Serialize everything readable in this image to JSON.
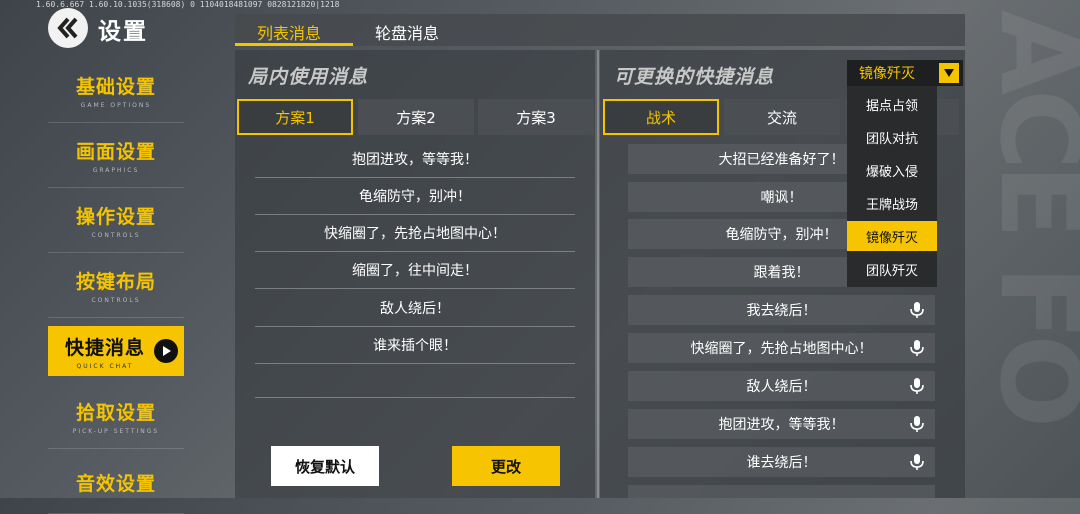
{
  "version_text": "1.60.6.667 1.60.10.1035(318608) 0 1104018481097 0828121820|1218",
  "header": {
    "title": "设置",
    "back_icon": "back-chevrons-icon"
  },
  "sidebar": {
    "items": [
      {
        "label": "基础设置",
        "sub": "GAME OPTIONS"
      },
      {
        "label": "画面设置",
        "sub": "GRAPHICS"
      },
      {
        "label": "操作设置",
        "sub": "CONTROLS"
      },
      {
        "label": "按键布局",
        "sub": "CONTROLS"
      },
      {
        "label": "快捷消息",
        "sub": "QUICK CHAT",
        "active": true
      },
      {
        "label": "拾取设置",
        "sub": "PICK-UP SETTINGS"
      },
      {
        "label": "音效设置",
        "sub": ""
      }
    ]
  },
  "tabs": [
    {
      "label": "列表消息",
      "active": true
    },
    {
      "label": "轮盘消息"
    }
  ],
  "left_panel": {
    "title": "局内使用消息",
    "schemes": [
      "方案1",
      "方案2",
      "方案3"
    ],
    "active_scheme": "方案1",
    "messages": [
      "抱团进攻，等等我！",
      "龟缩防守，别冲！",
      "快缩圈了，先抢占地图中心！",
      "缩圈了，往中间走！",
      "敌人绕后！",
      "谁来插个眼！",
      ""
    ],
    "reset_label": "恢复默认",
    "change_label": "更改"
  },
  "right_panel": {
    "title": "可更换的快捷消息",
    "categories": [
      "战术",
      "交流",
      ""
    ],
    "active_category": "战术",
    "messages": [
      "大招已经准备好了！",
      "嘲讽！",
      "龟缩防守，别冲！",
      "跟着我！",
      "我去绕后！",
      "快缩圈了，先抢占地图中心！",
      "敌人绕后！",
      "抱团进攻，等等我！",
      "谁去绕后！"
    ]
  },
  "dropdown": {
    "selected": "镜像歼灭",
    "options": [
      "据点占领",
      "团队对抗",
      "爆破入侵",
      "王牌战场",
      "镜像歼灭",
      "团队歼灭"
    ]
  },
  "colors": {
    "accent": "#f6c400",
    "panel": "#3a3e42"
  }
}
